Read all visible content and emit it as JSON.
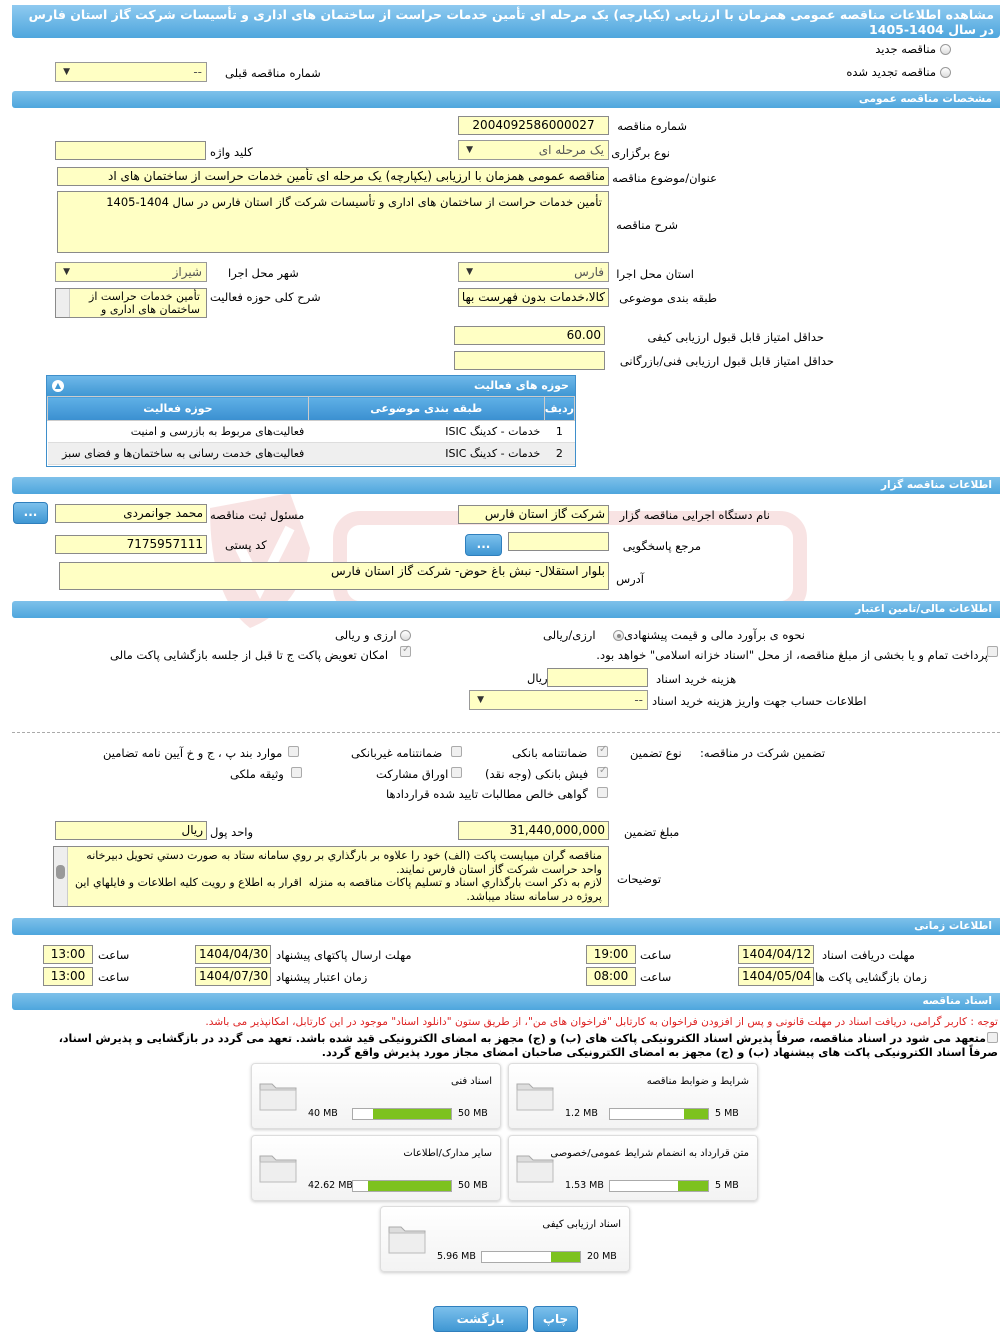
{
  "title": "مشاهده اطلاعات مناقصه عمومی همزمان با ارزیابی (یکپارچه) یک مرحله ای تأمین خدمات حراست از ساختمان های اداری و تأسیسات شرکت گاز استان فارس در سال 1404-1405",
  "top": {
    "new_label": "مناقصه جدید",
    "renewed_label": "مناقصه تجدید شده",
    "prev_number_label": "شماره مناقصه قبلی",
    "prev_number_value": "--"
  },
  "general": {
    "header": "مشخصات مناقصه عمومی",
    "number_label": "شماره مناقصه",
    "number": "2004092586000027",
    "type_label": "نوع برگزاری",
    "type": "یک مرحله ای",
    "keyword_label": "کلید واژه",
    "keyword": "",
    "subject_label": "عنوان/موضوع مناقصه",
    "subject": "مناقصه عمومی همزمان با ارزیابی (یکپارچه) یک مرحله ای تأمین خدمات حراست از ساختمان های اد",
    "desc_label": "شرح مناقصه",
    "desc": "تأمین خدمات حراست از ساختمان های اداری و تأسیسات شرکت گاز استان فارس در سال 1404-1405",
    "province_label": "استان محل اجرا",
    "province": "فارس",
    "city_label": "شهر محل اجرا",
    "city": "شیراز",
    "category_label": "طبقه بندی موضوعی",
    "category": "کالا،خدمات بدون فهرست بها",
    "activity_desc_label": "شرح کلی حوزه فعالیت",
    "activity_desc": "تأمین خدمات حراست از ساختمان های اداری و",
    "min_quality_label": "حداقل امتیاز قابل قبول ارزیابی کیفی",
    "min_quality": "60.00",
    "min_tech_label": "حداقل امتیاز قابل قبول ارزیابی فنی/بازرگانی",
    "min_tech": ""
  },
  "activities": {
    "header": "حوزه های فعالیت",
    "columns": [
      "ردیف",
      "طبقه بندی موضوعی",
      "حوزه فعالیت"
    ],
    "rows": [
      [
        "1",
        "خدمات - کدینگ ISIC",
        "فعالیت‌های مربوط به بازرسی و امنیت"
      ],
      [
        "2",
        "خدمات - کدینگ ISIC",
        "فعالیت‌های خدمت رسانی به ساختمان‌ها و فضای سبز"
      ]
    ]
  },
  "organizer": {
    "header": "اطلاعات مناقصه گزار",
    "org_label": "نام دستگاه اجرایی مناقصه گزار",
    "org": "شرکت گاز استان فارس",
    "reg_label": "مسئول ثبت مناقصه",
    "reg": "محمد  جوانمردی",
    "ref_label": "مرجع پاسخگویی",
    "ref": "",
    "postal_label": "کد پستی",
    "postal": "7175957111",
    "address_label": "آدرس",
    "address": "بلوار استقلال- نبش باغ حوض- شرکت گاز استان فارس",
    "more": "..."
  },
  "finance": {
    "header": "اطلاعات مالی/تامین اعتبار",
    "estimate_label": "نحوه ی برآورد مالی و قیمت پیشنهادی",
    "opt1": "ارزی/ریالی",
    "opt2": "ارزی و ریالی",
    "full_payment": "پرداخت تمام و یا بخشی از مبلغ مناقصه، از محل \"اسناد خزانه اسلامی\" خواهد بود.",
    "swap_label": "امکان تعویض پاکت ج تا قبل از جلسه بازگشایی پاکت مالی",
    "doc_cost_label": "هزینه خرید اسناد",
    "doc_cost": "",
    "rial": "ریال",
    "account_label": "اطلاعات حساب جهت واریز هزینه خرید اسناد",
    "account": "--"
  },
  "guarantee": {
    "label": "تضمین شرکت در مناقصه:",
    "type_label": "نوع تضمین",
    "o1": "ضمانتنامه بانکی",
    "o2": "ضمانتنامه غیربانکی",
    "o3": "موارد بند پ ، ج و خ آیین نامه تضامین",
    "o4": "فیش بانکی (وجه نقد)",
    "o5": "اوراق مشارکت",
    "o6": "وثیقه ملکی",
    "o7": "گواهی خالص مطالبات تایید شده قراردادها",
    "amount_label": "مبلغ تضمین",
    "amount": "31,440,000,000",
    "unit_label": "واحد پول",
    "unit": "ریال",
    "notes_label": "توضیحات",
    "notes": "مناقصه گران میبایست پاکت (الف) خود را علاوه بر بارگذاري بر روي سامانه ستاد به صورت دستي تحويل دبيرخانه واحد حراست شركت گاز استان فارس نمايند.\nلازم به ذكر است بارگذاري اسناد و تسليم پاكات مناقصه به منزله  اقرار به اطلاع و رويت كليه اطلاعات و فايلهاي اين پروژه در سامانه ستاد ميباشد."
  },
  "timing": {
    "header": "اطلاعات زمانی",
    "recv_label": "مهلت دریافت اسناد",
    "recv_date": "1404/04/12",
    "recv_time": "19:00",
    "send_label": "مهلت ارسال پاکتهای پیشنهاد",
    "send_date": "1404/04/30",
    "send_time": "13:00",
    "open_label": "زمان بازگشایی پاکت ها",
    "open_date": "1404/05/04",
    "open_time": "08:00",
    "valid_label": "زمان اعتبار پیشنهاد",
    "valid_date": "1404/07/30",
    "valid_time": "13:00",
    "time_label": "ساعت"
  },
  "docs": {
    "header": "اسناد مناقصه",
    "notice": "توجه : کاربر گرامی، دریافت اسناد در مهلت قانونی و پس از افزودن فراخوان به کارتابل \"فراخوان های من\"، از طریق ستون \"دانلود اسناد\" موجود در این کارتابل، امکانپذیر می باشد.",
    "commit1": "متعهد می شود در اسناد مناقصه، صرفاً پذیرش اسناد الکترونیکی پاکت های (ب) و (ج) مجهز به امضای الکترونیکی قید شده باشد. تعهد می گردد در بازگشایی و پذیرش اسناد،",
    "commit2": "صرفاً اسناد الکترونیکی پاکت های پیشنهاد (ب) و (ج) مجهز به امضای الکترونیکی صاحبان امضای مجاز مورد پذیرش واقع گردد.",
    "files": [
      {
        "name": "شرایط و ضوابط مناقصه",
        "used": "1.2 MB",
        "max": "5 MB",
        "pct": 24
      },
      {
        "name": "اسناد فنی",
        "used": "40 MB",
        "max": "50 MB",
        "pct": 80
      },
      {
        "name": "متن قرارداد به انضمام شرایط عمومی/خصوصی",
        "used": "1.53 MB",
        "max": "5 MB",
        "pct": 31
      },
      {
        "name": "سایر مدارک/اطلاعات",
        "used": "42.62 MB",
        "max": "50 MB",
        "pct": 85
      },
      {
        "name": "اسناد ارزیابی کیفی",
        "used": "5.96 MB",
        "max": "20 MB",
        "pct": 30
      }
    ]
  },
  "buttons": {
    "print": "چاپ",
    "back": "بازگشت"
  }
}
